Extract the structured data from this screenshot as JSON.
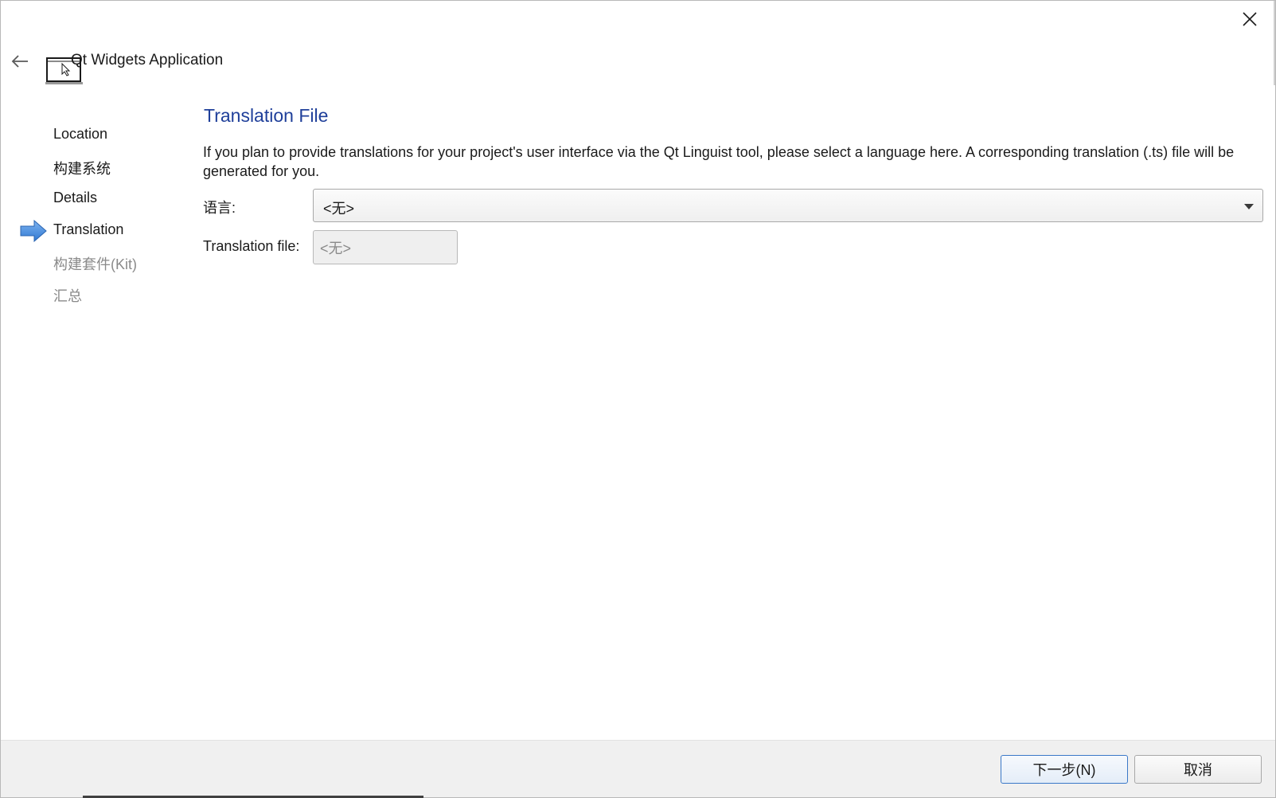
{
  "window": {
    "title": "Qt Widgets Application"
  },
  "icons": {
    "close": "close-icon",
    "back": "back-arrow-icon",
    "app": "qt-widgets-application-icon",
    "current_step": "current-step-arrow-icon",
    "dropdown": "chevron-down-icon"
  },
  "steps": [
    {
      "label": "Location",
      "state": "done"
    },
    {
      "label": "构建系统",
      "state": "done"
    },
    {
      "label": "Details",
      "state": "done"
    },
    {
      "label": "Translation",
      "state": "current"
    },
    {
      "label": "构建套件(Kit)",
      "state": "pending"
    },
    {
      "label": "汇总",
      "state": "pending"
    }
  ],
  "page": {
    "title": "Translation File",
    "description": "If you plan to provide translations for your project's user interface via the Qt Linguist tool, please select a language here. A corresponding translation (.ts) file will be generated for you.",
    "language_label": "语言:",
    "language_value": "<无>",
    "translation_file_label": "Translation file:",
    "translation_file_value": "<无>"
  },
  "footer": {
    "next_label": "下一步(N)",
    "cancel_label": "取消"
  },
  "colors": {
    "title_blue": "#1f3f9a",
    "step_arrow": "#4a90e2",
    "pending_text": "#8a8a8a",
    "default_button_border": "#3a78c8"
  }
}
